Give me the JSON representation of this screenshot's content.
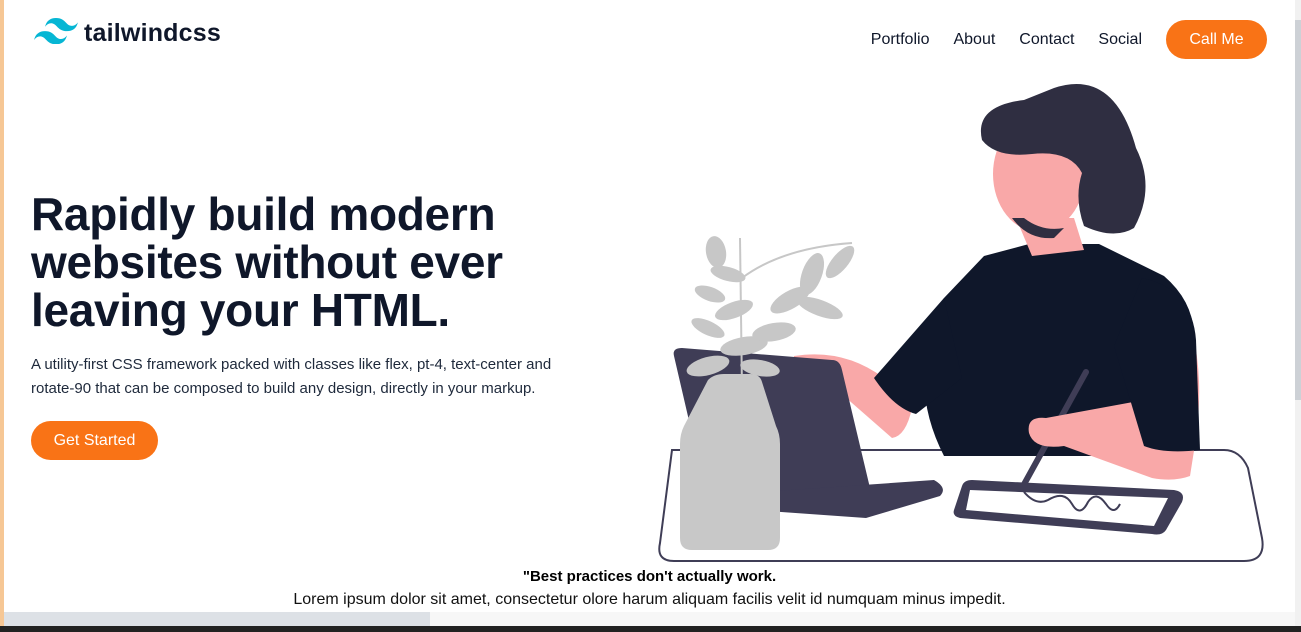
{
  "header": {
    "logo_text": "tailwindcss",
    "nav": [
      "Portfolio",
      "About",
      "Contact",
      "Social"
    ],
    "cta_label": "Call Me"
  },
  "hero": {
    "title_lines": [
      "Rapidly build modern",
      "websites without ever",
      "leaving your HTML."
    ],
    "subtitle_lines": [
      "A utility-first CSS framework packed with classes like flex, pt-4, text-center and",
      "rotate-90 that can be composed to build any design, directly in your markup."
    ],
    "button_label": "Get Started"
  },
  "quote": {
    "title": "\"Best practices don't actually work.",
    "text": "Lorem ipsum dolor sit amet, consectetur olore harum aliquam facilis velit id numquam minus impedit."
  },
  "colors": {
    "accent": "#f97316",
    "text_dark": "#0f172a",
    "logo_cyan": "#06b6d4",
    "frame": "#f6c795"
  },
  "icons": {
    "logo": "tailwind-wave-icon"
  }
}
